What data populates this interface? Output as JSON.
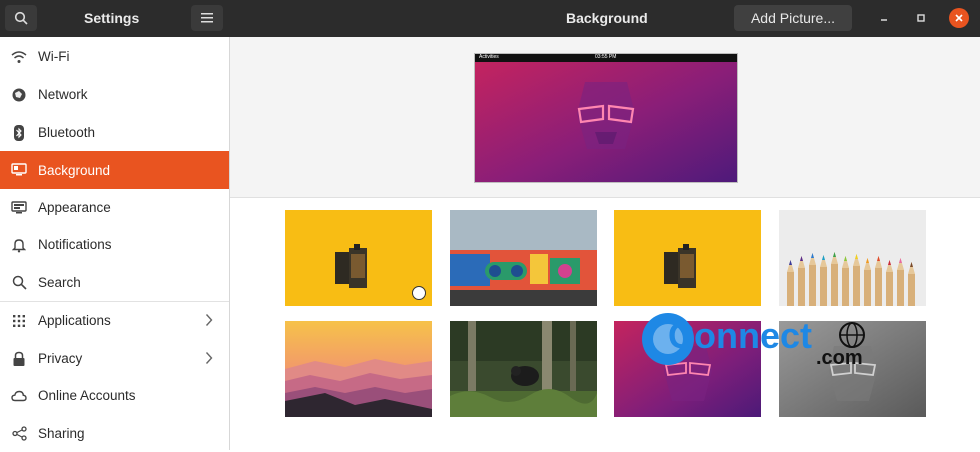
{
  "titlebar": {
    "left_title": "Settings",
    "main_title": "Background",
    "add_button": "Add Picture..."
  },
  "sidebar": {
    "items": [
      {
        "label": "Wi-Fi",
        "icon": "wifi-icon"
      },
      {
        "label": "Network",
        "icon": "network-icon"
      },
      {
        "label": "Bluetooth",
        "icon": "bluetooth-icon"
      },
      {
        "label": "Background",
        "icon": "display-icon",
        "active": true
      },
      {
        "label": "Appearance",
        "icon": "appearance-icon"
      },
      {
        "label": "Notifications",
        "icon": "bell-icon"
      },
      {
        "label": "Search",
        "icon": "search-icon"
      },
      {
        "label": "Applications",
        "icon": "grid-icon",
        "chevron": true
      },
      {
        "label": "Privacy",
        "icon": "lock-icon",
        "chevron": true
      },
      {
        "label": "Online Accounts",
        "icon": "cloud-icon"
      },
      {
        "label": "Sharing",
        "icon": "share-icon"
      }
    ]
  },
  "preview": {
    "topbar_left": "Activities",
    "topbar_center": "03:55 PM"
  },
  "watermark": {
    "text": "Connect",
    "suffix": ".com"
  },
  "colors": {
    "accent": "#e95420",
    "titlebar": "#2c2c2c"
  }
}
